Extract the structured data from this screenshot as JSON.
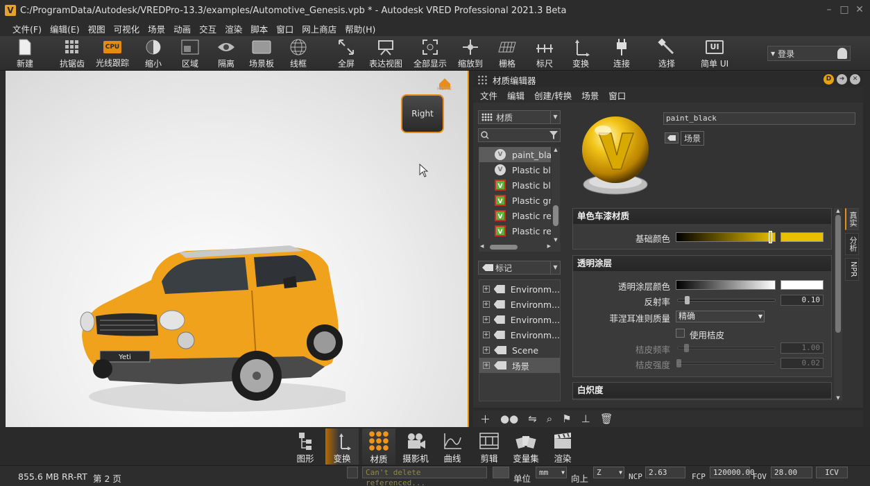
{
  "window": {
    "logo": "V",
    "title": "C:/ProgramData/Autodesk/VREDPro-13.3/examples/Automotive_Genesis.vpb * - Autodesk VRED Professional 2021.3 Beta"
  },
  "menu": [
    "文件(F)",
    "编辑(E)",
    "视图",
    "可视化",
    "场景",
    "动画",
    "交互",
    "渲染",
    "脚本",
    "窗口",
    "网上商店",
    "帮助(H)"
  ],
  "toolbar": {
    "new": "新建",
    "antialias": "抗锯齿",
    "raytracing": "光线跟踪",
    "cpu": "CPU",
    "zoom_out": "缩小",
    "region": "区域",
    "isolate": "隔离",
    "scene_plate": "场景板",
    "wireframe": "线框",
    "fullscreen": "全屏",
    "presentation": "表达视图",
    "show_all": "全部显示",
    "zoom_to": "缩放到",
    "grid": "栅格",
    "ruler": "标尺",
    "transform": "变换",
    "connect": "连接",
    "select": "选择",
    "simple_ui": "简单 UI",
    "ui_badge": "UI",
    "login": "登录"
  },
  "viewport": {
    "home_label": "HOME",
    "cube_face": "Right",
    "plate_text": "Yeti"
  },
  "material_editor": {
    "title": "材质编辑器",
    "menu": [
      "文件",
      "编辑",
      "创建/转换",
      "场景",
      "窗口"
    ],
    "filter_label": "材质",
    "materials": [
      {
        "name": "paint_black",
        "icon": "v"
      },
      {
        "name": "Plastic black",
        "icon": "v"
      },
      {
        "name": "Plastic black",
        "icon": "rv"
      },
      {
        "name": "Plastic grey",
        "icon": "rv"
      },
      {
        "name": "Plastic red",
        "icon": "rv"
      },
      {
        "name": "Plastic red",
        "icon": "rv"
      }
    ],
    "tags_label": "标记",
    "tags": [
      "Environm...",
      "Environm...",
      "Environm...",
      "Environm...",
      "Scene",
      "场景"
    ],
    "material_name": "paint_black",
    "scene_tag": "场景",
    "sections": {
      "base": {
        "title": "单色车漆材质",
        "base_color_label": "基础颜色"
      },
      "clearcoat": {
        "title": "透明涂层",
        "color_label": "透明涂层颜色",
        "reflectivity_label": "反射率",
        "reflectivity_value": "0.10",
        "fresnel_label": "菲涅耳准则质量",
        "fresnel_value": "精确",
        "orange_peel_label": "使用桔皮",
        "orange_peel_freq_label": "桔皮频率",
        "orange_peel_freq_value": "1.00",
        "orange_peel_intensity_label": "桔皮强度",
        "orange_peel_intensity_value": "0.02"
      },
      "incandescence": {
        "title": "白炽度"
      }
    },
    "side_tabs": [
      "真实",
      "分析",
      "NPR"
    ]
  },
  "dock": [
    "图形",
    "变换",
    "材质",
    "摄影机",
    "曲线",
    "剪辑",
    "变量集",
    "渲染"
  ],
  "status": {
    "memory": "855.6 MB",
    "mode": "RR-RT",
    "page": "第 2 页",
    "message": "Can't delete referenced...",
    "unit_label": "单位",
    "unit_value": "mm",
    "up_label": "向上",
    "up_value": "Z",
    "ncp_label": "NCP",
    "ncp_value": "2.63",
    "fcp_label": "FCP",
    "fcp_value": "120000.00",
    "fov_label": "FOV",
    "fov_value": "28.00",
    "icv": "ICV"
  },
  "colors": {
    "accent": "#e88d1b",
    "car_paint": "#f0a21c",
    "base_color": "#e8c000"
  }
}
